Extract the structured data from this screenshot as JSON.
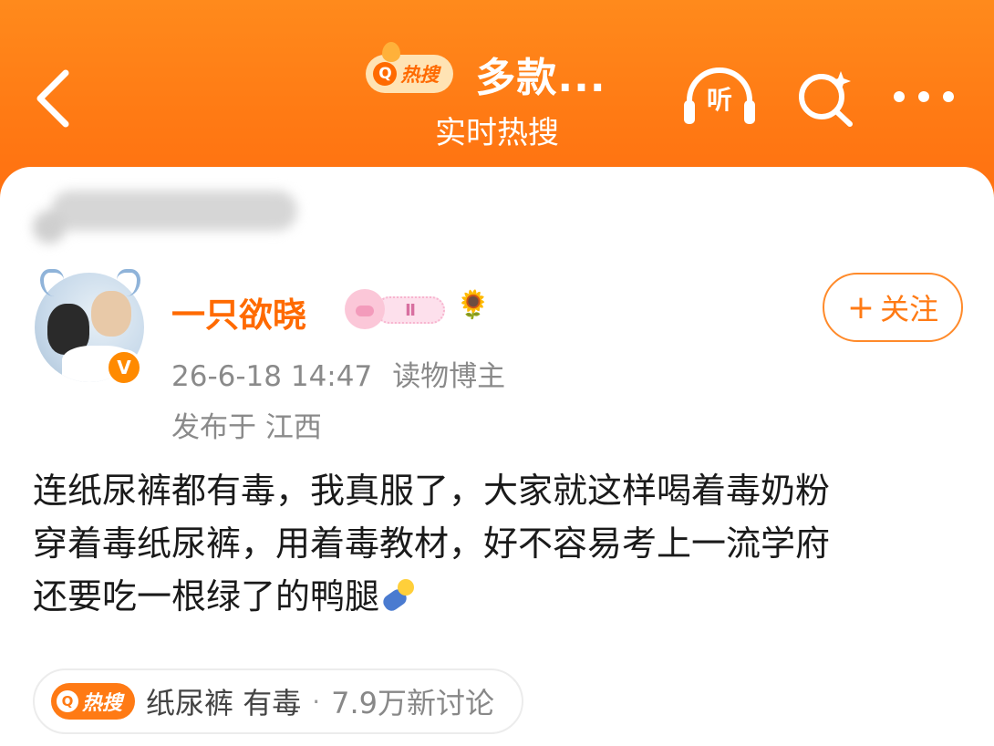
{
  "header": {
    "hot_badge": "热搜",
    "title": "多款...",
    "subtitle": "实时热搜",
    "listen_label": "听"
  },
  "post": {
    "username": "一只欲晓",
    "medal_level": "Ⅱ",
    "verified_mark": "V",
    "follow_label": "关注",
    "date": "26-6-18 14:47",
    "role": "读物博主",
    "location": "发布于 江西",
    "text_lines": [
      "连纸尿裤都有毒，我真服了，大家就这样喝着毒奶粉",
      "穿着毒纸尿裤，用着毒教材，好不容易考上一流学府",
      "还要吃一根绿了的鸭腿"
    ]
  },
  "hot_topic": {
    "tag": "热搜",
    "topic": "纸尿裤 有毒",
    "separator": "·",
    "count": "7.9万新讨论"
  },
  "colors": {
    "header_orange": "#ff7a14",
    "username_orange": "#ff6a00",
    "meta_gray": "#8a8a8a"
  }
}
